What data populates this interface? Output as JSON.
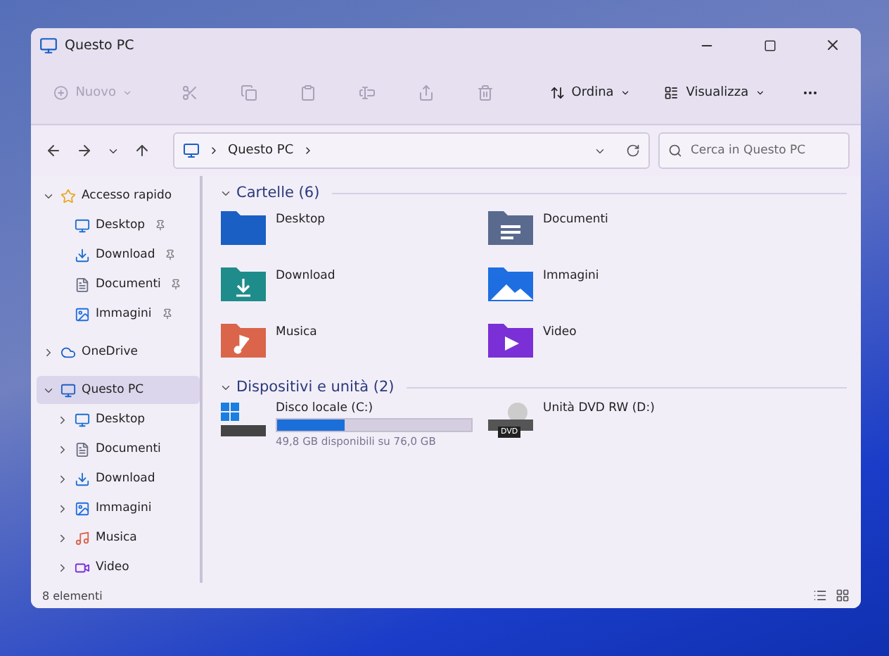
{
  "window": {
    "title": "Questo PC"
  },
  "toolbar": [
    {
      "kind": "new",
      "label": "Nuovo",
      "disabled": true
    },
    {
      "kind": "cut",
      "disabled": true
    },
    {
      "kind": "copy",
      "disabled": true
    },
    {
      "kind": "paste",
      "disabled": true
    },
    {
      "kind": "rename",
      "disabled": true
    },
    {
      "kind": "share",
      "disabled": true
    },
    {
      "kind": "delete",
      "disabled": true
    },
    {
      "kind": "sort",
      "label": "Ordina",
      "disabled": false
    },
    {
      "kind": "view",
      "label": "Visualizza",
      "disabled": false
    },
    {
      "kind": "more",
      "disabled": false
    }
  ],
  "address": {
    "path": [
      "Questo PC"
    ]
  },
  "search": {
    "placeholder": "Cerca in Questo PC"
  },
  "sidebar": {
    "items": [
      {
        "kind": "star",
        "label": "Accesso rapido",
        "expanded": true,
        "selected": false,
        "children": [
          {
            "kind": "desktop",
            "label": "Desktop",
            "pinned": true,
            "selected": false
          },
          {
            "kind": "download",
            "label": "Download",
            "pinned": true,
            "selected": false
          },
          {
            "kind": "documents",
            "label": "Documenti",
            "pinned": true,
            "selected": false
          },
          {
            "kind": "pictures",
            "label": "Immagini",
            "pinned": true,
            "selected": false
          }
        ]
      },
      {
        "kind": "cloud",
        "label": "OneDrive",
        "expanded": false,
        "selected": false
      },
      {
        "kind": "pc",
        "label": "Questo PC",
        "expanded": true,
        "selected": true,
        "children": [
          {
            "kind": "desktop",
            "label": "Desktop",
            "expanded": false,
            "selected": false
          },
          {
            "kind": "documents",
            "label": "Documenti",
            "expanded": false,
            "selected": false
          },
          {
            "kind": "download",
            "label": "Download",
            "expanded": false,
            "selected": false
          },
          {
            "kind": "pictures",
            "label": "Immagini",
            "expanded": false,
            "selected": false
          },
          {
            "kind": "music",
            "label": "Musica",
            "expanded": false,
            "selected": false
          },
          {
            "kind": "video",
            "label": "Video",
            "expanded": false,
            "selected": false
          }
        ]
      }
    ]
  },
  "folders": {
    "title": "Cartelle (6)",
    "expanded": true,
    "items": [
      {
        "kind": "desktop",
        "label": "Desktop",
        "color": "#1a5fc4"
      },
      {
        "kind": "documents",
        "label": "Documenti",
        "color": "#5a6a8e"
      },
      {
        "kind": "download",
        "label": "Download",
        "color": "#1f8c8a"
      },
      {
        "kind": "pictures",
        "label": "Immagini",
        "color": "#1e6fe0"
      },
      {
        "kind": "music",
        "label": "Musica",
        "color": "#d9654a"
      },
      {
        "kind": "video",
        "label": "Video",
        "color": "#7b2fd6"
      }
    ]
  },
  "drives": {
    "title": "Dispositivi e unità (2)",
    "expanded": true,
    "items": [
      {
        "kind": "disk",
        "label": "Disco locale (C:)",
        "level": 0.345,
        "detail": "49,8 GB disponibili su 76,0 GB"
      },
      {
        "kind": "dvd",
        "label": "Unità DVD RW (D:)",
        "badge": "DVD"
      }
    ]
  },
  "status_bar": {
    "count": "8 elementi"
  }
}
